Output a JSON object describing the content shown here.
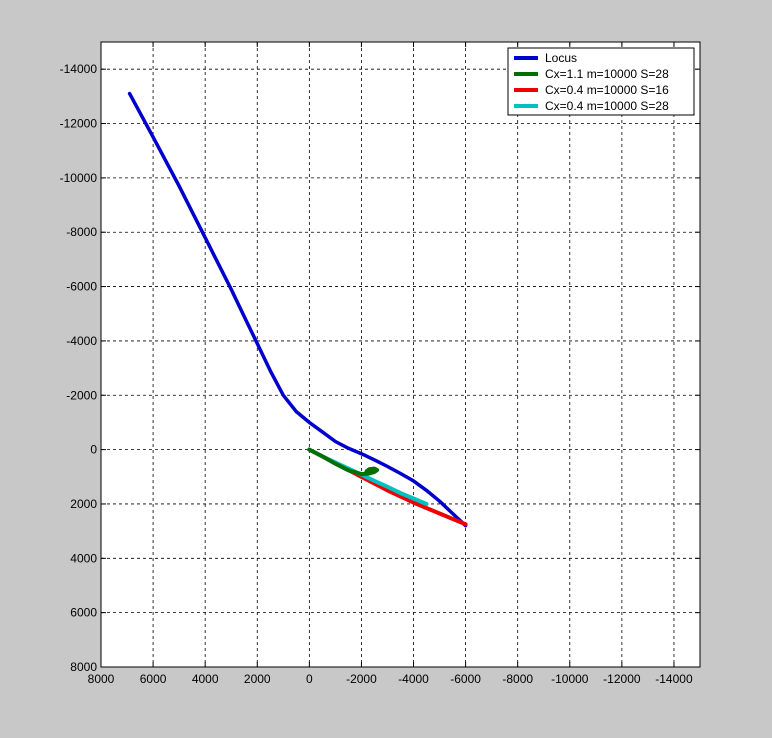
{
  "colors": {
    "figure_background": "#c8c8c8",
    "axes_background": "#ffffff",
    "grid": "#000000",
    "axis": "#000000"
  },
  "chart_data": {
    "type": "line",
    "title": "",
    "xlabel": "",
    "ylabel": "",
    "xlim": [
      8000,
      -15000
    ],
    "ylim": [
      8000,
      -15000
    ],
    "x_reversed": true,
    "y_reversed": true,
    "grid": true,
    "legend_position": "top-right",
    "xticks": [
      8000,
      6000,
      4000,
      2000,
      0,
      -2000,
      -4000,
      -6000,
      -8000,
      -10000,
      -12000,
      -14000
    ],
    "xtick_labels": [
      "8000",
      "6000",
      "4000",
      "2000",
      "0",
      "-2000",
      "-4000",
      "-6000",
      "-8000",
      "-10000",
      "-12000",
      "-14000"
    ],
    "yticks": [
      -14000,
      -12000,
      -10000,
      -8000,
      -6000,
      -4000,
      -2000,
      0,
      2000,
      4000,
      6000,
      8000
    ],
    "ytick_labels": [
      "-14000",
      "-12000",
      "-10000",
      "-8000",
      "-6000",
      "-4000",
      "-2000",
      "0",
      "2000",
      "4000",
      "6000",
      "8000"
    ],
    "series": [
      {
        "name": "Locus",
        "color": "#0000cc",
        "x": [
          6900,
          6000,
          5000,
          4000,
          3000,
          2500,
          2000,
          1500,
          1000,
          500,
          0,
          -500,
          -1000,
          -1500,
          -2000,
          -2500,
          -3000,
          -3500,
          -4000,
          -4500,
          -5000,
          -5500,
          -6000
        ],
        "y": [
          -13100,
          -11500,
          -9700,
          -7800,
          -5900,
          -4900,
          -3900,
          -2900,
          -2000,
          -1400,
          -1000,
          -650,
          -300,
          -50,
          150,
          380,
          620,
          880,
          1150,
          1500,
          1900,
          2350,
          2800
        ]
      },
      {
        "name": "Cx=1.1 m=10000 S=28",
        "color": "#007000",
        "x": [
          0,
          -500,
          -1000,
          -1500,
          -2000,
          -2300,
          -2500,
          -2600,
          -2500,
          -2300,
          -2200
        ],
        "y": [
          0,
          250,
          520,
          760,
          900,
          880,
          820,
          750,
          700,
          720,
          800
        ]
      },
      {
        "name": "Cx=0.4 m=10000 S=16",
        "color": "#ee0000",
        "x": [
          0,
          -1000,
          -2000,
          -3000,
          -4000,
          -5000,
          -6000
        ],
        "y": [
          0,
          500,
          1000,
          1500,
          1950,
          2350,
          2750
        ]
      },
      {
        "name": " Cx=0.4 m=10000 S=28",
        "color": "#00c0c0",
        "x": [
          0,
          -500,
          -1000,
          -1500,
          -2000,
          -2500,
          -3000,
          -3500,
          -4000,
          -4500
        ],
        "y": [
          0,
          250,
          470,
          700,
          920,
          1150,
          1370,
          1600,
          1800,
          2000
        ]
      }
    ]
  }
}
